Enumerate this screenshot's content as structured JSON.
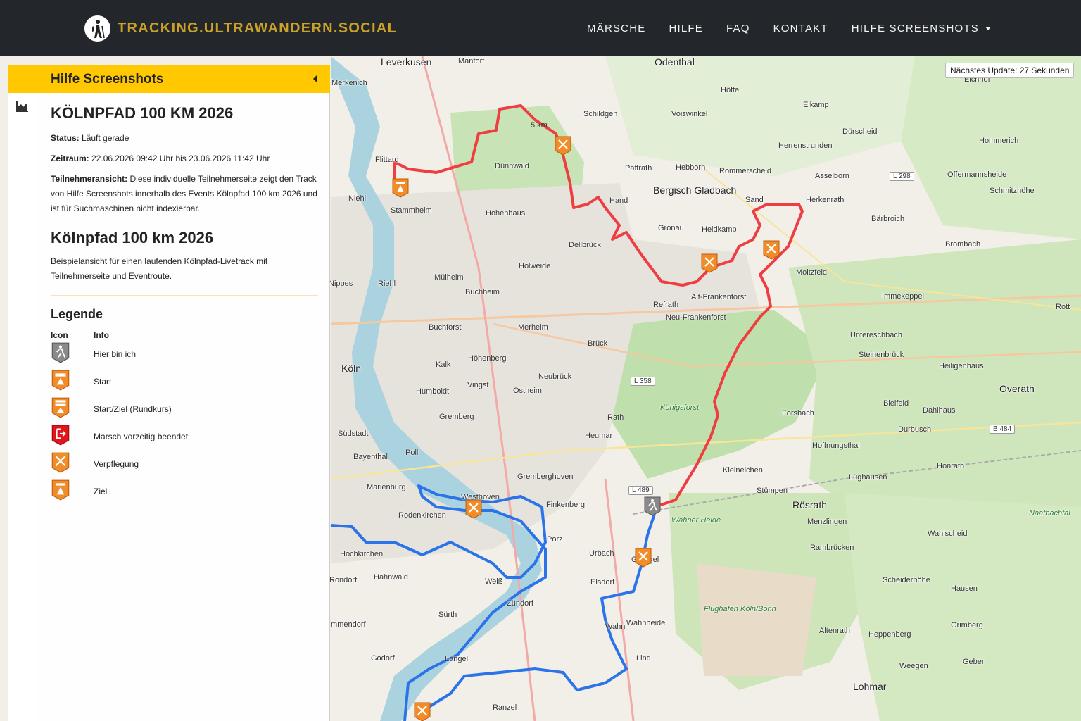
{
  "nav": {
    "brand": "TRACKING.ULTRAWANDERN.SOCIAL",
    "links": [
      "MÄRSCHE",
      "HILFE",
      "FAQ",
      "KONTAKT",
      "HILFE SCREENSHOTS"
    ]
  },
  "map": {
    "update_text": "Nächstes Update: 27 Sekunden",
    "scale_text": "5 km",
    "cities": [
      "Leverkusen",
      "Odenthal",
      "Bergisch Gladbach",
      "Köln",
      "Overath",
      "Rösrath",
      "Lohmar",
      "Mülheim"
    ],
    "places": [
      "Manfort",
      "Merkenich",
      "Schildgen",
      "Voiswinkel",
      "Höffe",
      "Eichhof",
      "Eikamp",
      "Dürscheid",
      "Hommerich",
      "Herrenstrunden",
      "Paffrath",
      "Hebborn",
      "Rommerscheid",
      "Asselborn",
      "Offermannsheide",
      "Schmitzhöhe",
      "Dünnwald",
      "Flittard",
      "Stammheim",
      "Niehl",
      "Hohenhaus",
      "Hand",
      "Gronau",
      "Heidkamp",
      "Sand",
      "Herkenrath",
      "Bärbroich",
      "Brombach",
      "Moitzfeld",
      "Dellbrück",
      "Holweide",
      "Buchheim",
      "Riehl",
      "Nippes",
      "Refrath",
      "Alt-Frankenforst",
      "Neu-Frankenforst",
      "Immekeppel",
      "Untereschbach",
      "Steinenbrück",
      "Heiligenhaus",
      "Merheim",
      "Buchforst",
      "Brück",
      "Kalk",
      "Höhenberg",
      "Neubrück",
      "Humboldt",
      "Vingst",
      "Ostheim",
      "Rath",
      "Gremberg",
      "Heumar",
      "Forsbach",
      "Bleifeld",
      "Dahlhaus",
      "Durbusch",
      "Hoffnungsthal",
      "Südstadt",
      "Poll",
      "Bayenthal",
      "Kleineichen",
      "Lüghausen",
      "Honrath",
      "Gremberghoven",
      "Stümpen",
      "Marienburg",
      "Westhoven",
      "Finkenberg",
      "Menzlingen",
      "Rodenkirchen",
      "Porz",
      "Urbach",
      "Wahlscheid",
      "Rambrücken",
      "Hochkirchen",
      "Grengel",
      "Elsdorf",
      "Hahnwald",
      "Weiß",
      "Rondorf",
      "Zündorf",
      "Scheiderhöhe",
      "Hausen",
      "Sürth",
      "Wahn",
      "Wahnheide",
      "Altenrath",
      "Immendorf",
      "Grimberg",
      "Heppenberg",
      "Godorf",
      "Langel",
      "Lind",
      "Geber",
      "Weegen",
      "Ranzel",
      "Rott",
      "Wahner Heide",
      "Königsforst",
      "Flughafen Köln/Bonn",
      "Naafbachtal"
    ],
    "roads": [
      "L 298",
      "L 358",
      "L 489",
      "B 484"
    ]
  },
  "panel": {
    "header_title": "Hilfe Screenshots",
    "event_title": "KÖLNPFAD 100 KM 2026",
    "status_label": "Status:",
    "status_value": "Läuft gerade",
    "period_label": "Zeitraum:",
    "period_value": "22.06.2026 09:42 Uhr bis 23.06.2026 11:42 Uhr",
    "view_label": "Teilnehmeransicht:",
    "view_value": "Diese individuelle Teilnehmerseite zeigt den Track von Hilfe Screenshots innerhalb des Events Kölnpfad 100 km 2026 und ist für Suchmaschinen nicht indexierbar.",
    "event_name": "Kölnpfad 100 km 2026",
    "description": "Beispielansicht für einen laufenden Kölnpfad-Livetrack mit Teilnehmerseite und Eventroute.",
    "legend_title": "Legende",
    "legend_col_icon": "Icon",
    "legend_col_info": "Info",
    "legend": [
      {
        "icon": "walker-icon",
        "label": "Hier bin ich"
      },
      {
        "icon": "start-icon",
        "label": "Start"
      },
      {
        "icon": "start-finish-icon",
        "label": "Start/Ziel (Rundkurs)"
      },
      {
        "icon": "exit-icon",
        "label": "Marsch vorzeitig beendet"
      },
      {
        "icon": "food-icon",
        "label": "Verpflegung"
      },
      {
        "icon": "finish-icon",
        "label": "Ziel"
      }
    ]
  },
  "colors": {
    "navbar": "#23272b",
    "brand": "#c9a227",
    "panel_header": "#ffc800",
    "track_done": "#2a73e8",
    "track_route": "#ef3e42"
  }
}
